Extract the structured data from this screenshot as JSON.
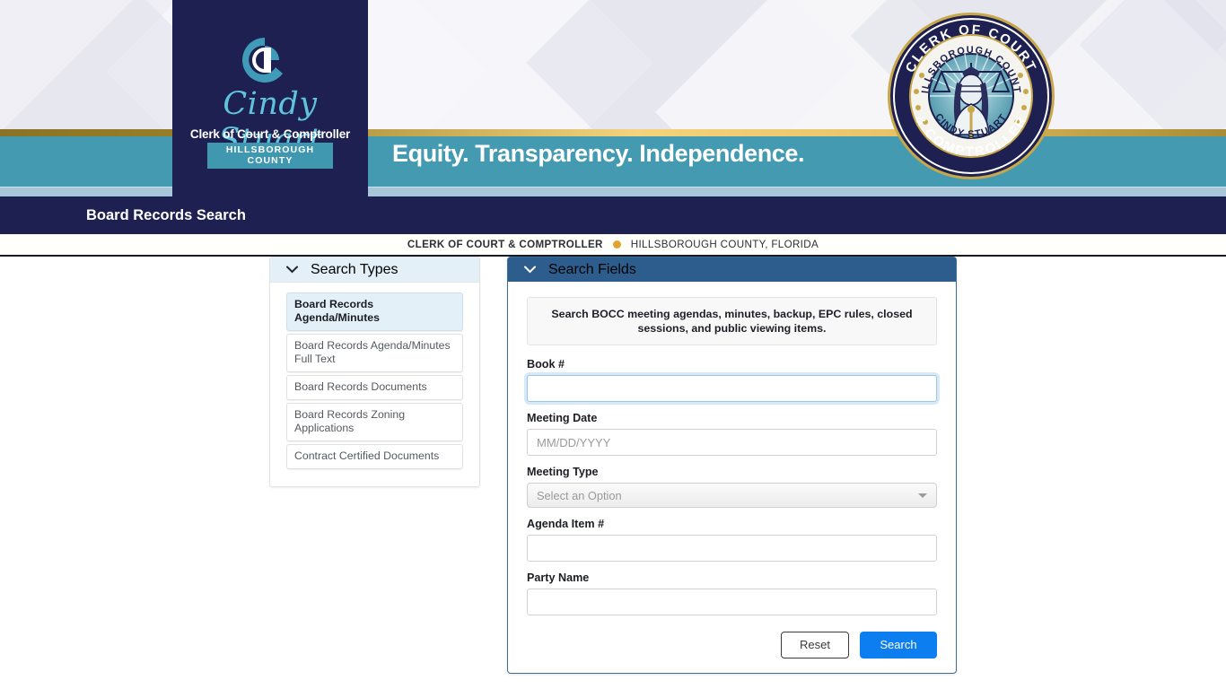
{
  "header": {
    "logo": {
      "script_name": "Cindy Stuart",
      "subtitle": "Clerk of Court & Comptroller",
      "county": "HILLSBOROUGH COUNTY",
      "mark": "c-monogram-icon"
    },
    "tagline": "Equity. Transparency. Independence.",
    "seal": {
      "top_text": "CLERK OF COURT",
      "bottom_text": "& COMPTROLLER",
      "inner_top_text": "HILLSBOROUGH COUNTY",
      "inner_bottom_text": "CINDY STUART",
      "emblem": "lady-justice-scales-icon"
    }
  },
  "titlebar": {
    "title": "Board Records Search"
  },
  "subbar": {
    "left": "CLERK OF COURT & COMPTROLLER",
    "right": "HILLSBOROUGH COUNTY, FLORIDA",
    "separator": "dot-separator-icon"
  },
  "search_types": {
    "header_label": "Search Types",
    "collapse_icon": "chevron-down-icon",
    "items": [
      {
        "label": "Board Records Agenda/Minutes",
        "active": true
      },
      {
        "label": "Board Records Agenda/Minutes Full Text",
        "active": false
      },
      {
        "label": "Board Records Documents",
        "active": false
      },
      {
        "label": "Board Records Zoning Applications",
        "active": false
      },
      {
        "label": "Contract Certified Documents",
        "active": false
      }
    ]
  },
  "search_fields": {
    "header_label": "Search Fields",
    "collapse_icon": "chevron-down-icon",
    "notice": "Search BOCC meeting agendas, minutes, backup, EPC rules, closed sessions, and public viewing items.",
    "fields": [
      {
        "label": "Book #",
        "value": "",
        "placeholder": "",
        "type": "text",
        "focused": true
      },
      {
        "label": "Meeting Date",
        "value": "",
        "placeholder": "MM/DD/YYYY",
        "type": "text",
        "focused": false
      },
      {
        "label": "Meeting Type",
        "value": "Select an Option",
        "type": "select",
        "caret": "caret-down-icon"
      },
      {
        "label": "Agenda Item #",
        "value": "",
        "placeholder": "",
        "type": "text",
        "focused": false
      },
      {
        "label": "Party Name",
        "value": "",
        "placeholder": "",
        "type": "text",
        "focused": false
      }
    ],
    "reset_label": "Reset",
    "search_label": "Search"
  },
  "colors": {
    "navy": "#1d2050",
    "teal": "#449bb1",
    "gold": "#c8a84b",
    "panel_header_blue": "#2d5d8c",
    "accent_blue": "#0d7ef0",
    "dot_orange": "#e0a32e"
  }
}
